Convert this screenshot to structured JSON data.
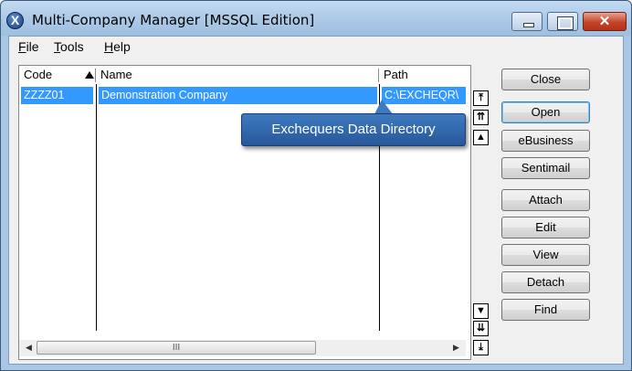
{
  "window": {
    "title": "Multi-Company Manager [MSSQL Edition]",
    "app_icon": "x-logo-icon",
    "close_glyph": "✕"
  },
  "menu": {
    "items": [
      {
        "label": "File"
      },
      {
        "label": "Tools"
      },
      {
        "label": "Help"
      }
    ]
  },
  "list": {
    "columns": [
      {
        "label": "Code"
      },
      {
        "label": "Name"
      },
      {
        "label": "Path"
      }
    ],
    "sort_column": "Code",
    "sort_direction": "descending",
    "rows": [
      {
        "code": "ZZZZ01",
        "name": "Demonstration Company",
        "path": "C:\\EXCHEQR\\"
      }
    ],
    "hscroll_grip": "III"
  },
  "nav": {
    "first": "⤒",
    "page_up": "⇈",
    "up": "▲",
    "down": "▼",
    "page_down": "⇊",
    "last": "⤓"
  },
  "buttons": {
    "close": "Close",
    "open": "Open",
    "ebusiness": "eBusiness",
    "sentimail": "Sentimail",
    "attach": "Attach",
    "edit": "Edit",
    "view": "View",
    "detach": "Detach",
    "find": "Find"
  },
  "tooltip": {
    "text": "Exchequers Data Directory"
  },
  "colors": {
    "selection": "#3399ff",
    "tooltip": "#2f66ad",
    "window_frame": "#a9c7e4"
  }
}
